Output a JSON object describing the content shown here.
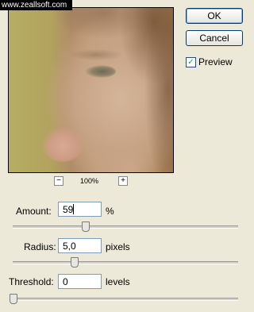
{
  "watermark": "www.zeallsoft.com",
  "zoom": {
    "minus": "−",
    "plus": "+",
    "level": "100%"
  },
  "buttons": {
    "ok": "OK",
    "cancel": "Cancel"
  },
  "preview_option": {
    "label": "Preview",
    "checked": true,
    "check_glyph": "✓"
  },
  "fields": {
    "amount": {
      "label": "Amount:",
      "value": "59",
      "unit": "%",
      "slider_fraction": 0.32
    },
    "radius": {
      "label": "Radius:",
      "value": "5,0",
      "unit": "pixels",
      "slider_fraction": 0.27
    },
    "threshold": {
      "label": "Threshold:",
      "value": "0",
      "unit": "levels",
      "slider_fraction": 0.0
    }
  }
}
